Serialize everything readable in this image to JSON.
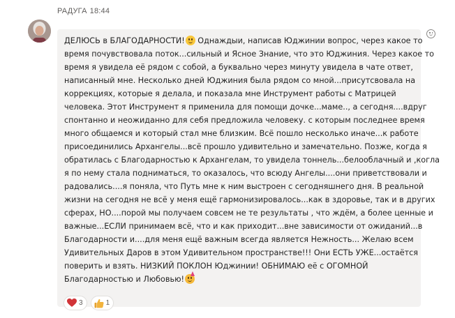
{
  "message": {
    "sender": "РАДУГА",
    "time": "18:44",
    "lines": [
      "ДЕЛЮСЬ в БЛАГОДАРНОСТИ!",
      " Однаждыи, написав Юджинии вопрос, через какое то",
      "время почувствовала поток...сильный и Ясное Знание, что это Юджиния. Через какое то",
      "время я увидела её рядом с собой, а буквально через минуту увидела в чате ответ,",
      "написанный мне. Несколько дней Юджиния была рядом со мной...присутсвовала на",
      "коррекциях, которые я делала, и показала мне Инструмент работы с Матрицей",
      "человека.  Этот Инструмент я применила для помощи дочке...маме.., а сегодня....вдруг",
      "спонтанно и неожиданно для себя предложила человеку. с которым последнее время",
      "много общаемся и который стал мне близким. Всё пошло несколько иначе...к работе",
      "присоединились Архангелы...всё прошло удивительно и замечательно. Позже, когда я",
      "обратилась с Благодарностью к Архангелам, то увидела тоннель...белооблачный и ,когла",
      "я по нему стала подниматься, то оказалось, что всюду Ангелы....они приветствовали и",
      "радовались....я поняла, что Путь мне к ним выстроен с сегодняшнего дня.  В реальной",
      "жизни на сегодня не всё у меня ещё гармонизировалось...как в здоровье, так и в других",
      "сферах, НО....порой мы получаем совсем не те результаты , что ждём, а более ценные и",
      "важные...ЕСЛИ принимаем всё, что и как приходит...вне зависимости от ожиданий...в",
      "Благодарности и....для меня ещё важным всегда является Нежность...  Желаю всем",
      "Удивительных Даров в этом Удивительном пространстве!!! Они ЕСТЬ УЖЕ...остаётся",
      "поверить и взять. НИЗКИЙ ПОКЛОН Юджинии! ОБНИМАЮ её с ОГОМНОЙ",
      "Благодарностью и Любовью!"
    ],
    "emojis": [
      "smiling-face-emoji",
      "partying-face-emoji"
    ]
  },
  "reactions": [
    {
      "icon": "heart-icon",
      "color": "#d13438",
      "count": "3"
    },
    {
      "icon": "thumbs-up-icon",
      "color": "#f2b33d",
      "count": "1"
    }
  ],
  "colors": {
    "bubble": "#f3f2f1",
    "text": "#242424",
    "meta": "#605e5c"
  }
}
